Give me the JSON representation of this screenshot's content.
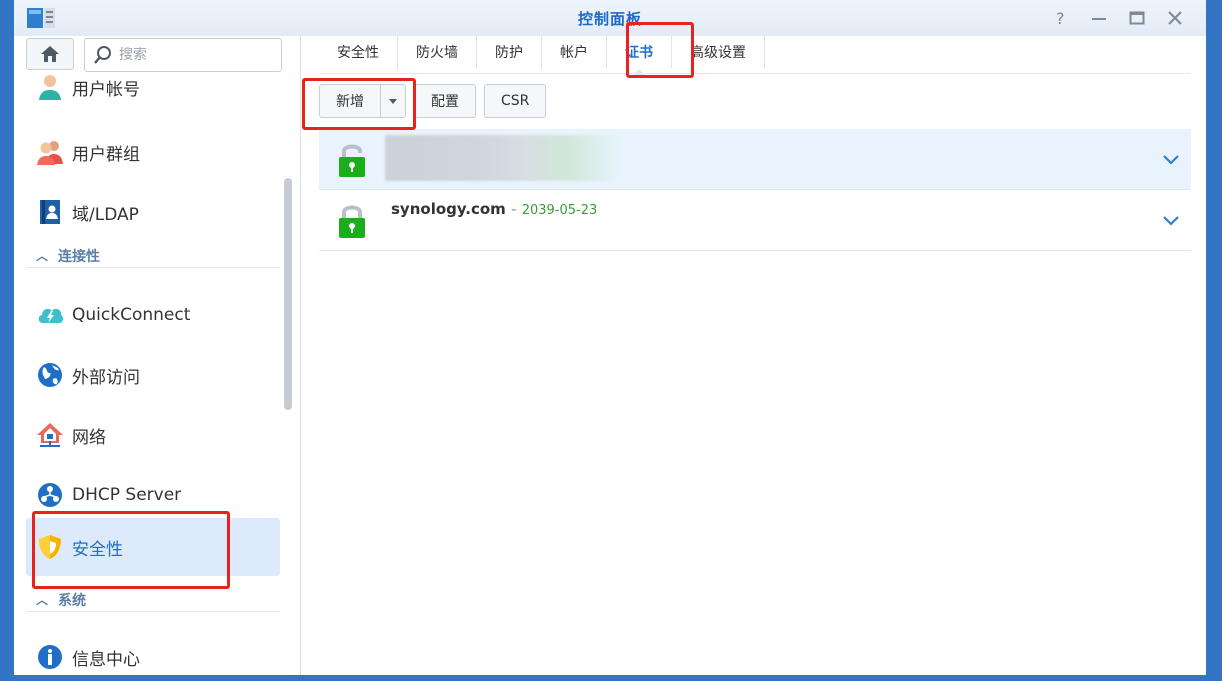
{
  "window": {
    "title": "控制面板"
  },
  "sidebar": {
    "search_placeholder": "搜索",
    "items": [
      {
        "label": "用户帐号",
        "icon": "user-icon"
      },
      {
        "label": "用户群组",
        "icon": "user-group-icon"
      },
      {
        "label": "域/LDAP",
        "icon": "directory-icon"
      }
    ],
    "section_connectivity": "连接性",
    "connectivity_items": [
      {
        "label": "QuickConnect",
        "icon": "cloud-icon"
      },
      {
        "label": "外部访问",
        "icon": "globe-icon"
      },
      {
        "label": "网络",
        "icon": "network-house-icon"
      },
      {
        "label": "DHCP Server",
        "icon": "dhcp-icon"
      },
      {
        "label": "安全性",
        "icon": "shield-icon",
        "active": true
      }
    ],
    "section_system": "系统",
    "system_items": [
      {
        "label": "信息中心",
        "icon": "info-icon"
      }
    ]
  },
  "tabs": [
    {
      "label": "安全性"
    },
    {
      "label": "防火墙"
    },
    {
      "label": "防护"
    },
    {
      "label": "帐户"
    },
    {
      "label": "证书",
      "active": true
    },
    {
      "label": "高级设置"
    }
  ],
  "toolbar": {
    "add_label": "新增",
    "configure_label": "配置",
    "csr_label": "CSR"
  },
  "certificates": [
    {
      "name": "",
      "date": "",
      "selected": true,
      "redacted": true
    },
    {
      "name": "synology.com",
      "separator": "-",
      "date": "2039-05-23",
      "selected": false
    }
  ],
  "colors": {
    "accent": "#1f6fc7",
    "frame": "#3474c4",
    "highlight": "#e8231c",
    "date_green": "#3d9a38",
    "lock_green": "#1aae1a"
  }
}
